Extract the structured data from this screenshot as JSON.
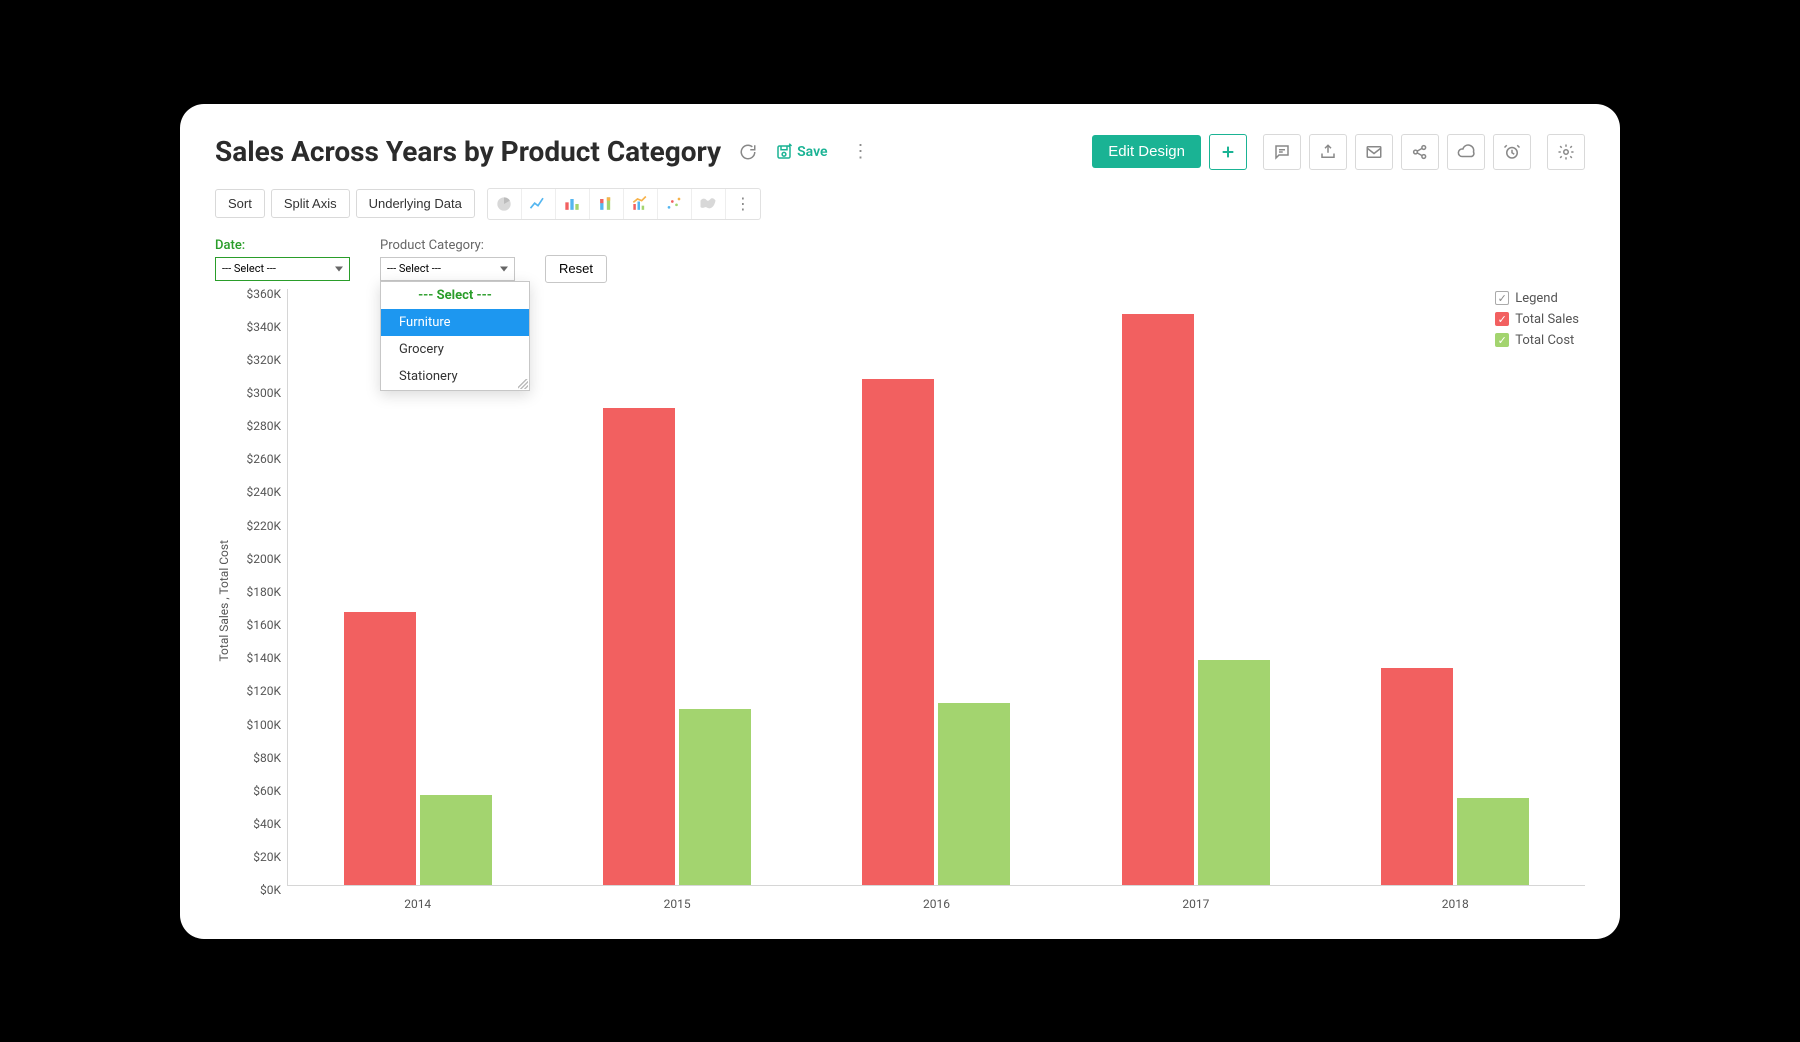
{
  "header": {
    "title": "Sales Across Years by Product Category",
    "save_label": "Save",
    "edit_design": "Edit Design"
  },
  "toolbar": {
    "sort": "Sort",
    "split_axis": "Split Axis",
    "underlying_data": "Underlying Data"
  },
  "filters": {
    "date_label": "Date:",
    "date_value": "--- Select ---",
    "category_label": "Product Category:",
    "category_value": "--- Select ---",
    "reset": "Reset",
    "dropdown": {
      "header": "--- Select ---",
      "options": [
        "Furniture",
        "Grocery",
        "Stationery"
      ],
      "hovered_index": 0
    }
  },
  "legend": {
    "title": "Legend",
    "series_a": "Total Sales",
    "series_b": "Total Cost"
  },
  "chart_data": {
    "type": "bar",
    "title": "Sales Across Years by Product Category",
    "xlabel": "",
    "ylabel": "Total Sales , Total Cost",
    "ylim": [
      0,
      380000
    ],
    "y_ticks": [
      "$360K",
      "$340K",
      "$320K",
      "$300K",
      "$280K",
      "$260K",
      "$240K",
      "$220K",
      "$200K",
      "$180K",
      "$160K",
      "$140K",
      "$120K",
      "$100K",
      "$80K",
      "$60K",
      "$40K",
      "$20K",
      "$0K"
    ],
    "categories": [
      "2014",
      "2015",
      "2016",
      "2017",
      "2018"
    ],
    "series": [
      {
        "name": "Total Sales",
        "values": [
          174000,
          304000,
          322000,
          364000,
          138000
        ],
        "color": "#f26060"
      },
      {
        "name": "Total Cost",
        "values": [
          57000,
          112000,
          116000,
          143000,
          55000
        ],
        "color": "#a3d46f"
      }
    ]
  }
}
